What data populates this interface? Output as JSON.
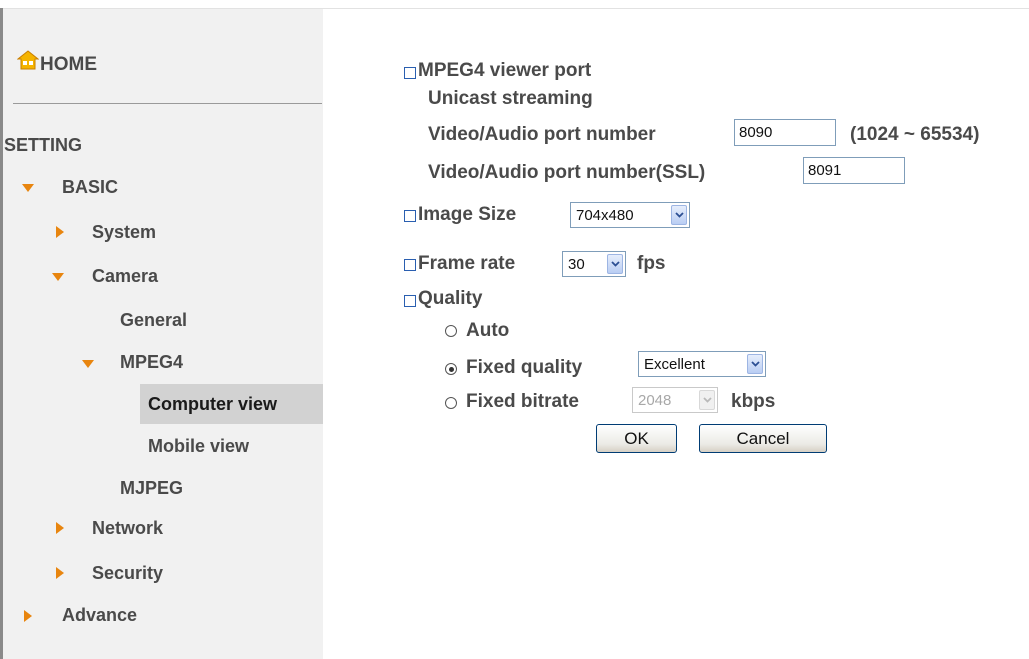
{
  "sidebar": {
    "home": "HOME",
    "setting": "SETTING",
    "basic": "BASIC",
    "system": "System",
    "camera": "Camera",
    "general": "General",
    "mpeg4": "MPEG4",
    "computer_view": "Computer view",
    "mobile_view": "Mobile view",
    "mjpeg": "MJPEG",
    "network": "Network",
    "security": "Security",
    "advance": "Advance"
  },
  "form": {
    "viewer_port": {
      "title": "MPEG4 viewer port",
      "unicast": "Unicast streaming",
      "port_label": "Video/Audio port number",
      "port_value": "8090",
      "port_range": "(1024 ~ 65534)",
      "ssl_label": "Video/Audio port number(SSL)",
      "ssl_value": "8091"
    },
    "image_size": {
      "label": "Image Size",
      "value": "704x480"
    },
    "frame_rate": {
      "label": "Frame rate",
      "value": "30",
      "unit": "fps"
    },
    "quality": {
      "label": "Quality",
      "auto": "Auto",
      "fixed_quality": "Fixed quality",
      "fixed_quality_value": "Excellent",
      "fixed_bitrate": "Fixed bitrate",
      "fixed_bitrate_value": "2048",
      "bitrate_unit": "kbps",
      "selected": "fixed_quality"
    },
    "ok": "OK",
    "cancel": "Cancel"
  },
  "colors": {
    "accent_triangle": "#e8850f",
    "selected_bg": "#d2d2d2",
    "sidebar_bg": "#f1f1f1"
  }
}
